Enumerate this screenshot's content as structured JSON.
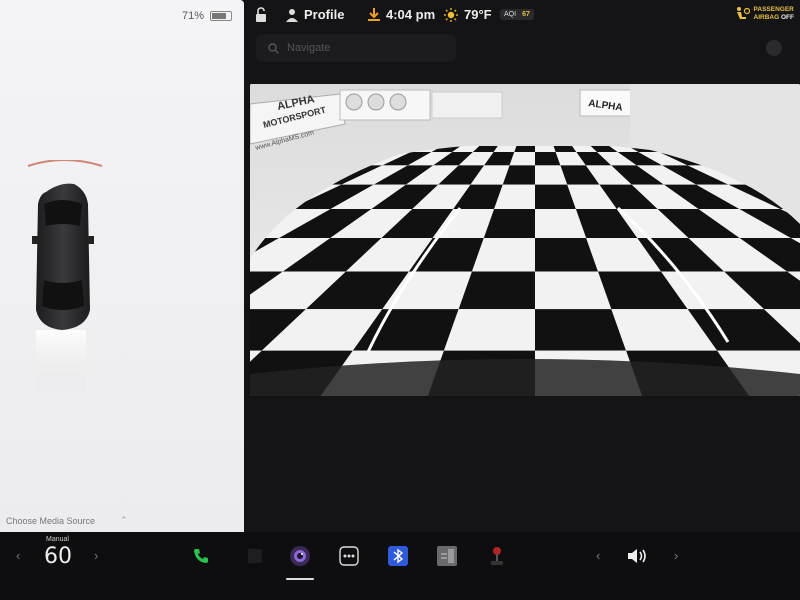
{
  "status": {
    "battery_percent": "71%",
    "battery_level": 0.71,
    "profile_label": "Profile",
    "time": "4:04 pm",
    "temperature": "79°F",
    "aqi_label": "AQI",
    "aqi_value": "67",
    "airbag_line1": "PASSENGER",
    "airbag_line2": "AIRBAG",
    "airbag_line3": "OFF"
  },
  "navigation": {
    "placeholder": "Navigate"
  },
  "camera": {
    "sign_alpha": "ALPHA",
    "sign_motors": "MOTORSPORT",
    "sign_url": "www.AlphaMS.com",
    "sign_right": "ALPHA"
  },
  "left_panel": {
    "media_source": "Choose Media Source"
  },
  "dock": {
    "speed_mode": "Manual",
    "speed_value": "60",
    "left_chevron": "‹",
    "right_chevron": "›",
    "vol_left_chevron": "‹",
    "vol_right_chevron": "›"
  },
  "icons": {
    "lock": "lock-icon",
    "profile": "person-icon",
    "download": "download-icon",
    "weather": "sun-icon",
    "airbag": "airbag-icon",
    "phone": "phone-icon",
    "camera": "camera-icon",
    "more": "more-icon",
    "bluetooth": "bluetooth-icon",
    "notepad": "notepad-icon",
    "joystick": "joystick-icon",
    "volume": "volume-icon"
  },
  "colors": {
    "accent_orange": "#f0a020",
    "airbag_yellow": "#e8c040",
    "phone_green": "#2fbf4f",
    "bluetooth_blue": "#2f5bd8",
    "guide_lines": "#ffffff"
  }
}
